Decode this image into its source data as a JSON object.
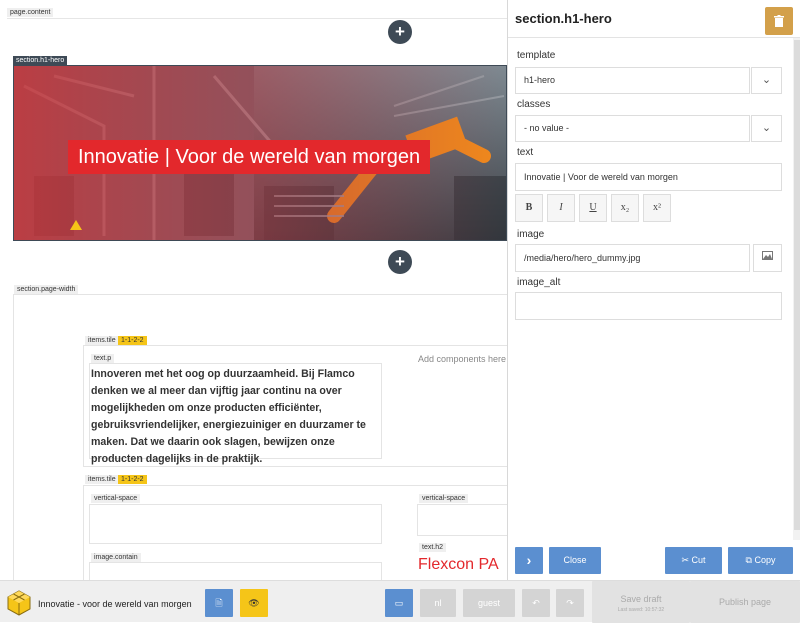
{
  "canvas": {
    "page_content_tag": "page.content",
    "hero_tag": "section.h1-hero",
    "hero_title": "Innovatie | Voor de wereld van morgen",
    "page_width_tag": "section.page-width",
    "tile1_tag": "items.tile",
    "tile1_badge": "1-1-2-2",
    "textp_tag": "text.p",
    "paragraph": "Innoveren met het oog op duurzaamheid. Bij Flamco denken we al meer dan vijftig jaar continu na over mogelijkheden om onze producten efficiënter, gebruiksvriendelijker, energiezuiniger en duurzamer te maken. Dat we daarin ook slagen, bewijzen onze producten dagelijks in de praktijk.",
    "add_components": "Add components here",
    "tile2_tag": "items.tile",
    "tile2_badge": "1-1-2-2",
    "vspace1_tag": "vertical-space",
    "vspace2_tag": "vertical-space",
    "image_contain_tag": "image.contain",
    "texth2_tag": "text.h2",
    "h2_text": "Flexcon PA",
    "plus": "+"
  },
  "panel": {
    "title": "section.h1-hero",
    "delete_icon": "trash-icon",
    "template_label": "template",
    "template_value": "h1-hero",
    "classes_label": "classes",
    "classes_value": "- no value -",
    "text_label": "text",
    "text_value": "Innovatie | Voor de wereld van morgen",
    "format_buttons": [
      "B",
      "I",
      "U",
      "x₂",
      "x²"
    ],
    "image_label": "image",
    "image_value": "/media/hero/hero_dummy.jpg",
    "image_alt_label": "image_alt",
    "image_alt_value": "",
    "next_label": "›",
    "close_label": "Close",
    "cut_label": "Cut",
    "copy_label": "Copy"
  },
  "bottombar": {
    "page_name": "Innovatie - voor de wereld van morgen",
    "lang": "nl",
    "user": "guest",
    "save_draft": "Save draft",
    "last_saved": "Last saved: 10:57:32",
    "publish": "Publish page"
  },
  "colors": {
    "accent_blue": "#5b8fd0",
    "dark": "#3e4a56",
    "hero_red": "#e3282c",
    "yellow": "#f5c518",
    "delete": "#d3a04a"
  }
}
